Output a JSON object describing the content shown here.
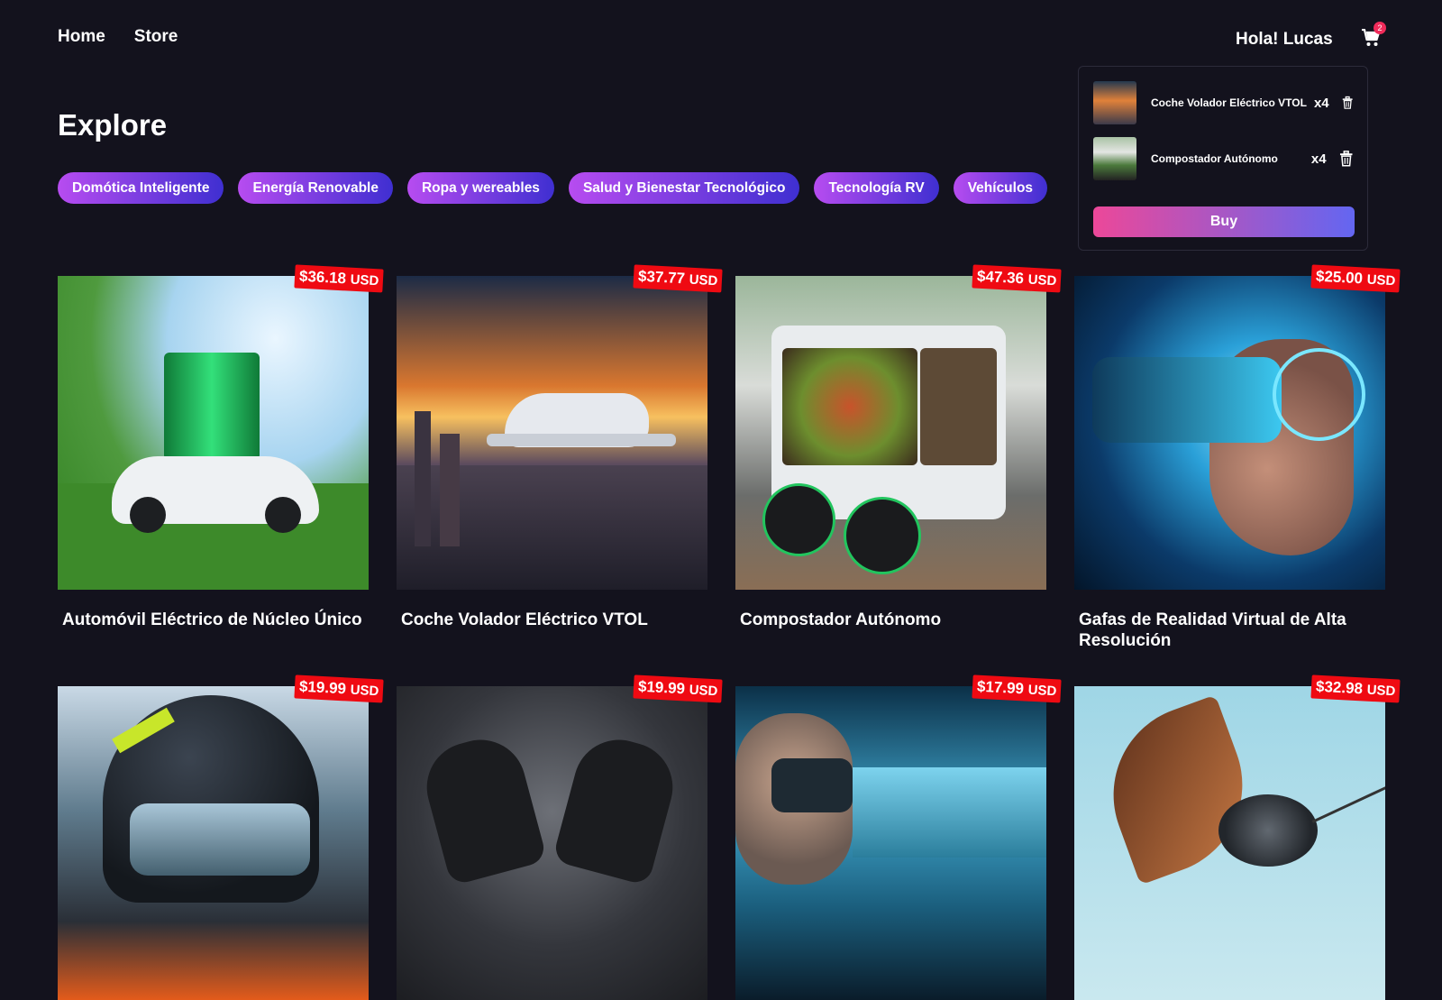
{
  "nav": {
    "home": "Home",
    "store": "Store"
  },
  "user": {
    "greeting": "Hola! Lucas"
  },
  "cart": {
    "count": "2",
    "items": [
      {
        "name": "Coche Volador Eléctrico VTOL",
        "qty": "x4"
      },
      {
        "name": "Compostador Autónomo",
        "qty": "x4"
      }
    ],
    "buy_label": "Buy"
  },
  "page": {
    "title": "Explore"
  },
  "categories": [
    "Domótica Inteligente",
    "Energía Renovable",
    "Ropa y wereables",
    "Salud y Bienestar Tecnológico",
    "Tecnología RV",
    "Vehículos"
  ],
  "currency": "USD",
  "products": [
    {
      "title": "Automóvil Eléctrico de Núcleo Único",
      "price": "$36.18"
    },
    {
      "title": "Coche Volador Eléctrico VTOL",
      "price": "$37.77"
    },
    {
      "title": "Compostador Autónomo",
      "price": "$47.36"
    },
    {
      "title": "Gafas de Realidad Virtual de Alta Resolución",
      "price": "$25.00"
    },
    {
      "title": "",
      "price": "$19.99"
    },
    {
      "title": "",
      "price": "$19.99"
    },
    {
      "title": "",
      "price": "$17.99"
    },
    {
      "title": "",
      "price": "$32.98"
    }
  ],
  "colors": {
    "background": "#13121d",
    "price_tag": "#ef0a12",
    "chip_from": "#b74cf0",
    "chip_to": "#3f2fd1",
    "buy_from": "#ec4899",
    "buy_to": "#6366f1"
  }
}
